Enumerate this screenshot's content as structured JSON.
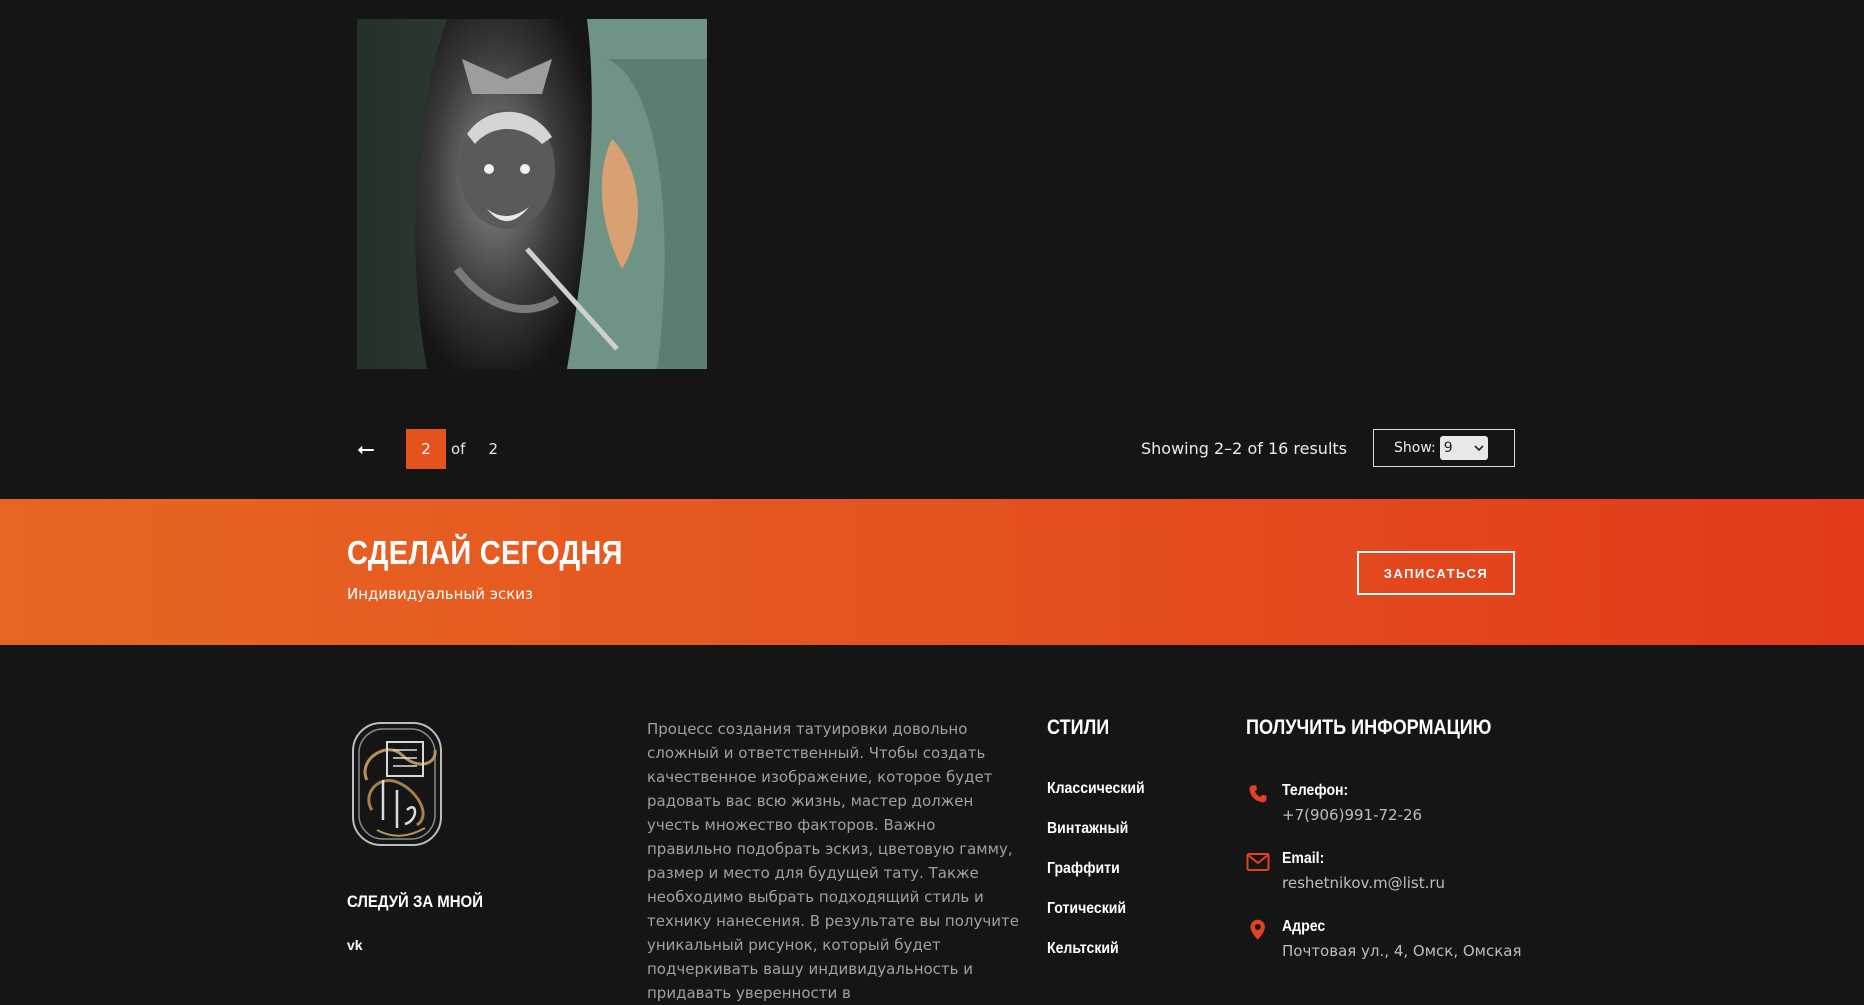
{
  "gallery": {
    "image_alt": "Samurai sleeve tattoo"
  },
  "pagination": {
    "prev_icon": "arrow-left-icon",
    "prev_glyph": "⭠",
    "current": "2",
    "of_label": "of",
    "total": "2"
  },
  "results": {
    "text": "Showing 2–2 of 16 results",
    "show_label": "Show:",
    "show_value": "9"
  },
  "cta": {
    "title": "СДЕЛАЙ СЕГОДНЯ",
    "subtitle": "Индивидуальный эскиз",
    "button_label": "ЗАПИСАТЬСЯ",
    "gradient": [
      "#e76623",
      "#e23a1b"
    ]
  },
  "footer": {
    "follow_title": "СЛЕДУЙ ЗА МНОЙ",
    "social_vk": "vk",
    "about_text": "Процесс создания татуировки довольно сложный и ответственный. Чтобы создать качественное изображение, которое будет радовать вас всю жизнь, мастер должен учесть множество факторов. Важно правильно подобрать эскиз, цветовую гамму, размер и место для будущей тату. Также необходимо выбрать подходящий стиль и технику нанесения. В результате вы получите уникальный рисунок, который будет подчеркивать вашу индивидуальность и придавать уверенности в",
    "styles_title": "СТИЛИ",
    "styles": [
      "Классический",
      "Винтажный",
      "Граффити",
      "Готический",
      "Кельтский"
    ],
    "info_title": "ПОЛУЧИТЬ ИНФОРМАЦИЮ",
    "phone_label": "Телефон:",
    "phone_value": "+7(906)991-72-26",
    "email_label": "Email:",
    "email_value": "reshetnikov.m@list.ru",
    "address_label": "Адрес",
    "address_value": "Почтовая ул., 4, Омск, Омская",
    "accent": "#e4421e"
  }
}
